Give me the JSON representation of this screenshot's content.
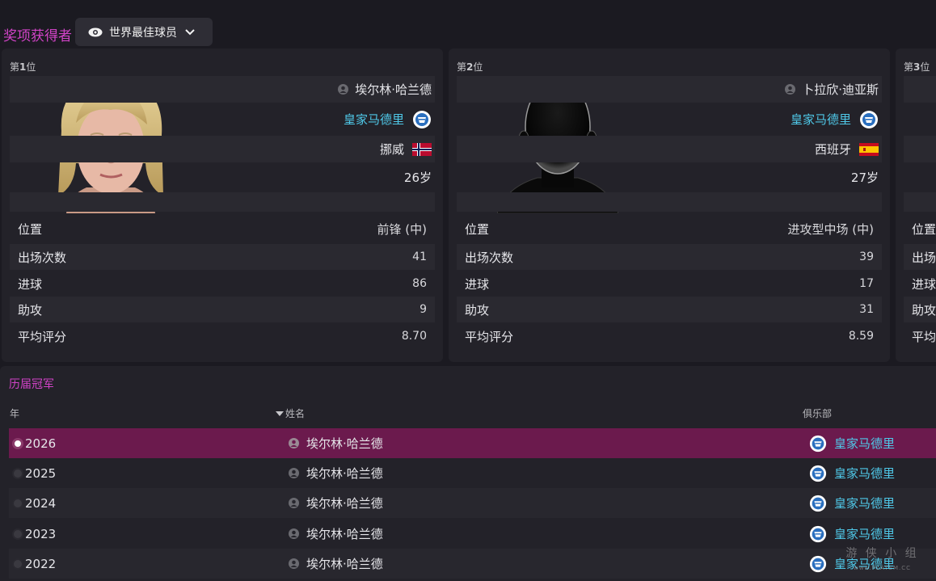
{
  "header": {
    "award_label": "奖项获得者",
    "award_select_value": "世界最佳球员"
  },
  "cards": [
    {
      "rank_prefix": "第",
      "rank_num": "1",
      "rank_suffix": "位",
      "player_name": "埃尔林·哈兰德",
      "club": "皇家马德里",
      "nation": "挪威",
      "age": "26岁",
      "stats": [
        {
          "label": "位置",
          "value": "前锋 (中)"
        },
        {
          "label": "出场次数",
          "value": "41"
        },
        {
          "label": "进球",
          "value": "86"
        },
        {
          "label": "助攻",
          "value": "9"
        },
        {
          "label": "平均评分",
          "value": "8.70"
        }
      ]
    },
    {
      "rank_prefix": "第",
      "rank_num": "2",
      "rank_suffix": "位",
      "player_name": "卜拉欣·迪亚斯",
      "club": "皇家马德里",
      "nation": "西班牙",
      "age": "27岁",
      "stats": [
        {
          "label": "位置",
          "value": "进攻型中场 (中)"
        },
        {
          "label": "出场次数",
          "value": "39"
        },
        {
          "label": "进球",
          "value": "17"
        },
        {
          "label": "助攻",
          "value": "31"
        },
        {
          "label": "平均评分",
          "value": "8.59"
        }
      ]
    },
    {
      "rank_prefix": "第",
      "rank_num": "3",
      "rank_suffix": "位",
      "stats": [
        {
          "label": "位置"
        },
        {
          "label": "出场"
        },
        {
          "label": "进球"
        },
        {
          "label": "助攻"
        },
        {
          "label": "平均"
        }
      ]
    }
  ],
  "history": {
    "title": "历届冠军",
    "col_year": "年",
    "col_name": "姓名",
    "col_club": "俱乐部",
    "rows": [
      {
        "year": "2026",
        "name": "埃尔林·哈兰德",
        "club": "皇家马德里"
      },
      {
        "year": "2025",
        "name": "埃尔林·哈兰德",
        "club": "皇家马德里"
      },
      {
        "year": "2024",
        "name": "埃尔林·哈兰德",
        "club": "皇家马德里"
      },
      {
        "year": "2023",
        "name": "埃尔林·哈兰德",
        "club": "皇家马德里"
      },
      {
        "year": "2022",
        "name": "埃尔林·哈兰德",
        "club": "皇家马德里"
      }
    ]
  },
  "watermark": {
    "line1": "游 侠 小 组",
    "line2": "www.PLAYSM.CC"
  },
  "colors": {
    "accent": "#d043c6",
    "club": "#4fc8e8",
    "selected_row": "#6b1a4d"
  }
}
